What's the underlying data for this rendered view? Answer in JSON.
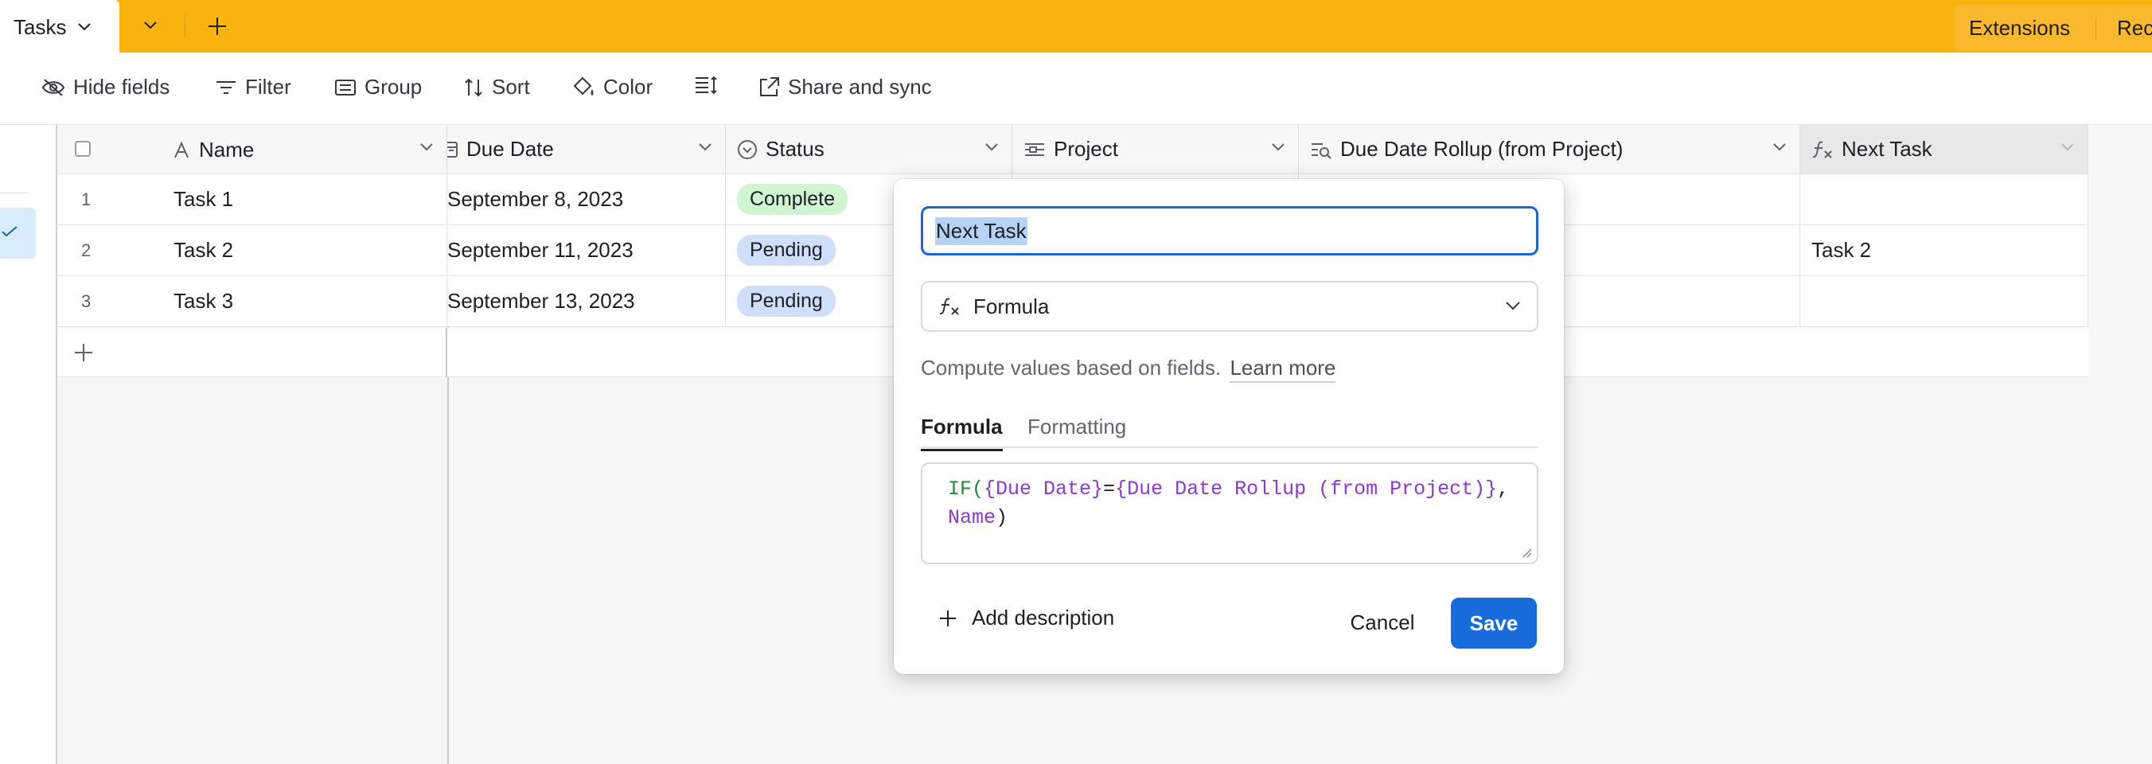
{
  "topbar": {
    "active_tab": "Tasks",
    "extensions_label": "Extensions",
    "record_label": "Rec",
    "accent_color": "#f8b40d"
  },
  "toolbar": {
    "hide_fields": "Hide fields",
    "filter": "Filter",
    "group": "Group",
    "sort": "Sort",
    "color": "Color",
    "share_and_sync": "Share and sync"
  },
  "table": {
    "columns": [
      {
        "label": "Name",
        "icon": "text-icon"
      },
      {
        "label": "Due Date",
        "icon": "calendar-icon"
      },
      {
        "label": "Status",
        "icon": "single-select-icon"
      },
      {
        "label": "Project",
        "icon": "link-icon"
      },
      {
        "label": "Due Date Rollup (from Project)",
        "icon": "rollup-icon"
      },
      {
        "label": "Next Task",
        "icon": "formula-icon"
      }
    ],
    "rows": [
      {
        "num": "1",
        "name": "Task 1",
        "due_date": "September 8, 2023",
        "status": "Complete",
        "next_task": ""
      },
      {
        "num": "2",
        "name": "Task 2",
        "due_date": "September 11, 2023",
        "status": "Pending",
        "next_task": "Task 2"
      },
      {
        "num": "3",
        "name": "Task 3",
        "due_date": "September 13, 2023",
        "status": "Pending",
        "next_task": ""
      }
    ]
  },
  "popup": {
    "field_name": "Next Task",
    "field_type": "Formula",
    "helper_text": "Compute values based on fields.",
    "learn_more": "Learn more",
    "tabs": [
      "Formula",
      "Formatting"
    ],
    "formula": {
      "fn": "IF(",
      "field1": "{Due Date}",
      "op": "=",
      "field2": "{Due Date Rollup (from Project)}",
      "comma": ",",
      "field3": "Name",
      "close": ")"
    },
    "add_description": "Add description",
    "cancel": "Cancel",
    "save": "Save"
  }
}
